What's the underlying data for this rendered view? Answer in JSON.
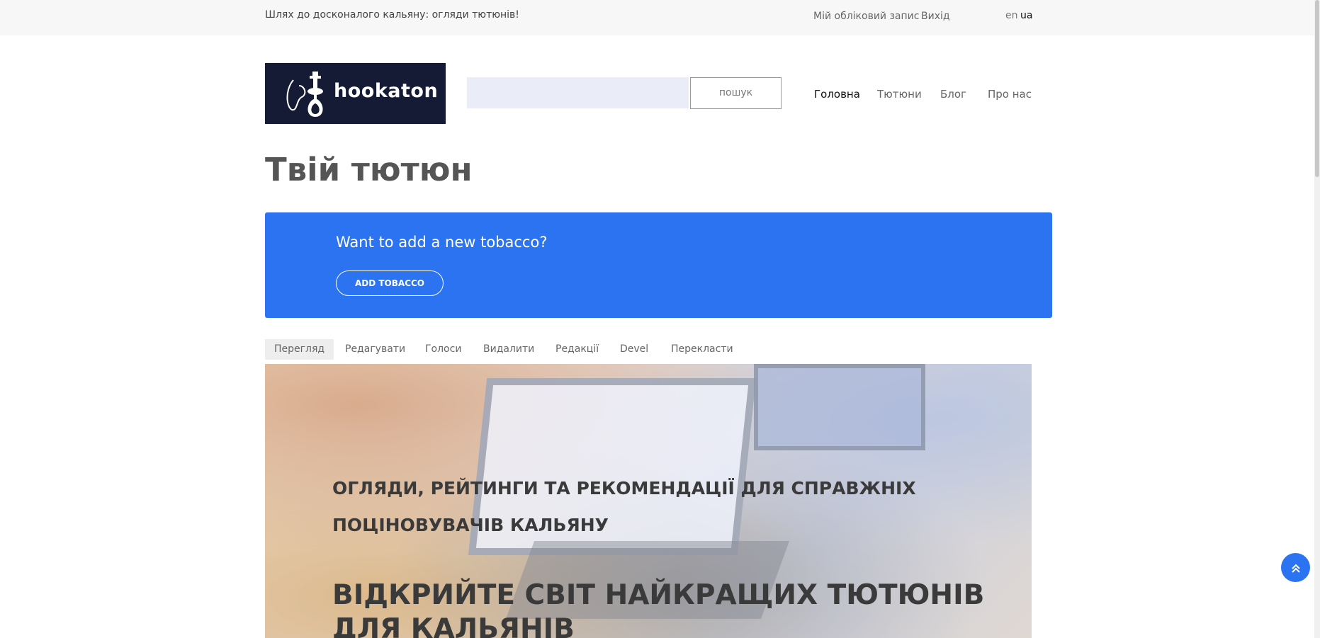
{
  "topbar": {
    "tagline": "Шлях до досконалого кальяну: огляди тютюнів!",
    "account": "Мій обліковий запис",
    "logout": "Вихід",
    "lang_en": "en",
    "lang_ua": "ua"
  },
  "logo": {
    "text": "hookaton"
  },
  "search": {
    "placeholder": "",
    "button": "пошук"
  },
  "nav": [
    {
      "label": "Головна",
      "active": true
    },
    {
      "label": "Тютюни"
    },
    {
      "label": "Блог"
    },
    {
      "label": "Про нас"
    }
  ],
  "page": {
    "title": "Твій тютюн"
  },
  "banner": {
    "text": "Want to add a new tobacco?",
    "button": "ADD TOBACCO",
    "color": "#2b73f0"
  },
  "tabs": [
    {
      "label": "Перегляд",
      "active": true
    },
    {
      "label": "Редагувати"
    },
    {
      "label": "Голоси"
    },
    {
      "label": "Видалити"
    },
    {
      "label": "Редакції"
    },
    {
      "label": "Devel"
    },
    {
      "label": "Перекласти"
    }
  ],
  "hero": {
    "subtitle": "ОГЛЯДИ, РЕЙТИНГИ ТА РЕКОМЕНДАЦІЇ ДЛЯ СПРАВЖНІХ ПОЦІНОВУВАЧІВ КАЛЬЯНУ",
    "title": "ВІДКРИЙТЕ СВІТ НАЙКРАЩИХ ТЮТЮНІВ ДЛЯ КАЛЬЯНІВ"
  },
  "icons": {
    "to_top": "double-chevron-up-icon",
    "logo": "hookah-icon"
  }
}
